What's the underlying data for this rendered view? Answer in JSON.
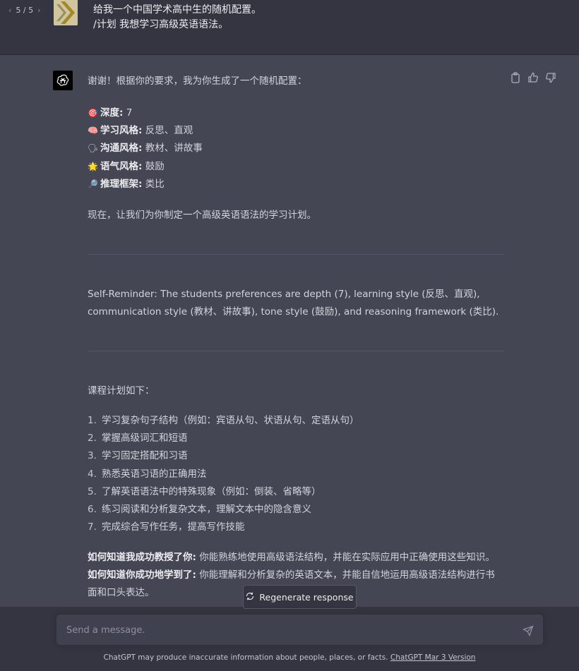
{
  "pager": {
    "label": "5 / 5"
  },
  "user": {
    "lines": [
      "给我一个中国学术高中生的随机配置。",
      "/计划 我想学习高级英语语法。"
    ]
  },
  "assistant": {
    "intro": "谢谢！根据你的要求，我为你生成了一个随机配置：",
    "profile": [
      {
        "emoji": "🎯",
        "key": "深度:",
        "value": " 7"
      },
      {
        "emoji": "🧠",
        "key": "学习风格:",
        "value": " 反思、直观"
      },
      {
        "emoji": "🗣",
        "key": "沟通风格:",
        "value": " 教材、讲故事"
      },
      {
        "emoji": "🌟",
        "key": "语气风格:",
        "value": " 鼓励"
      },
      {
        "emoji": "🔎",
        "key": "推理框架:",
        "value": " 类比"
      }
    ],
    "now_text": "现在，让我们为你制定一个高级英语语法的学习计划。",
    "reminder": "Self-Reminder: The students preferences are depth (7), learning style (反思、直观), communication style (教材、讲故事), tone style (鼓励), and reasoning framework (类比).",
    "plan_title": "课程计划如下：",
    "plan_items": [
      {
        "num": "1.",
        "text": "学习复杂句子结构（例如：宾语从句、状语从句、定语从句）"
      },
      {
        "num": "2.",
        "text": "掌握高级词汇和短语"
      },
      {
        "num": "3.",
        "text": "学习固定搭配和习语"
      },
      {
        "num": "4.",
        "text": "熟悉英语习语的正确用法"
      },
      {
        "num": "5.",
        "text": "了解英语语法中的特殊现象（例如：倒装、省略等）"
      },
      {
        "num": "6.",
        "text": "练习阅读和分析复杂文本，理解文本中的隐含意义"
      },
      {
        "num": "7.",
        "text": "完成综合写作任务，提高写作技能"
      }
    ],
    "taught_label": "如何知道我成功教授了你:",
    "taught_text": " 你能熟练地使用高级语法结构，并能在实际应用中正确使用这些知识。",
    "learned_label": "如何知道你成功地学到了:",
    "learned_text": " 你能理解和分析复杂的英语文本，并能自信地运用高级语法结构进行书面和口头表达。"
  },
  "regenerate": {
    "label": "Regenerate response"
  },
  "composer": {
    "placeholder": "Send a message."
  },
  "footer": {
    "text": "ChatGPT may produce inaccurate information about people, places, or facts. ",
    "link": "ChatGPT Mar 3 Version"
  },
  "colors": {
    "page_bg": "#343541",
    "assistant_bg": "#444654",
    "input_bg": "#40414f"
  }
}
